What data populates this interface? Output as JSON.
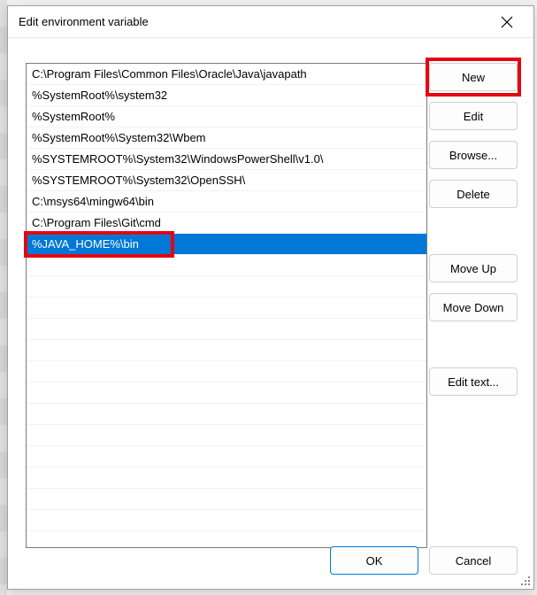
{
  "title": "Edit environment variable",
  "items": [
    "C:\\Program Files\\Common Files\\Oracle\\Java\\javapath",
    "%SystemRoot%\\system32",
    "%SystemRoot%",
    "%SystemRoot%\\System32\\Wbem",
    "%SYSTEMROOT%\\System32\\WindowsPowerShell\\v1.0\\",
    "%SYSTEMROOT%\\System32\\OpenSSH\\",
    "C:\\msys64\\mingw64\\bin",
    "C:\\Program Files\\Git\\cmd",
    "%JAVA_HOME%\\bin"
  ],
  "selected_index": 8,
  "buttons": {
    "new": "New",
    "edit": "Edit",
    "browse": "Browse...",
    "delete": "Delete",
    "moveup": "Move Up",
    "movedown": "Move Down",
    "edittext": "Edit text...",
    "ok": "OK",
    "cancel": "Cancel"
  }
}
